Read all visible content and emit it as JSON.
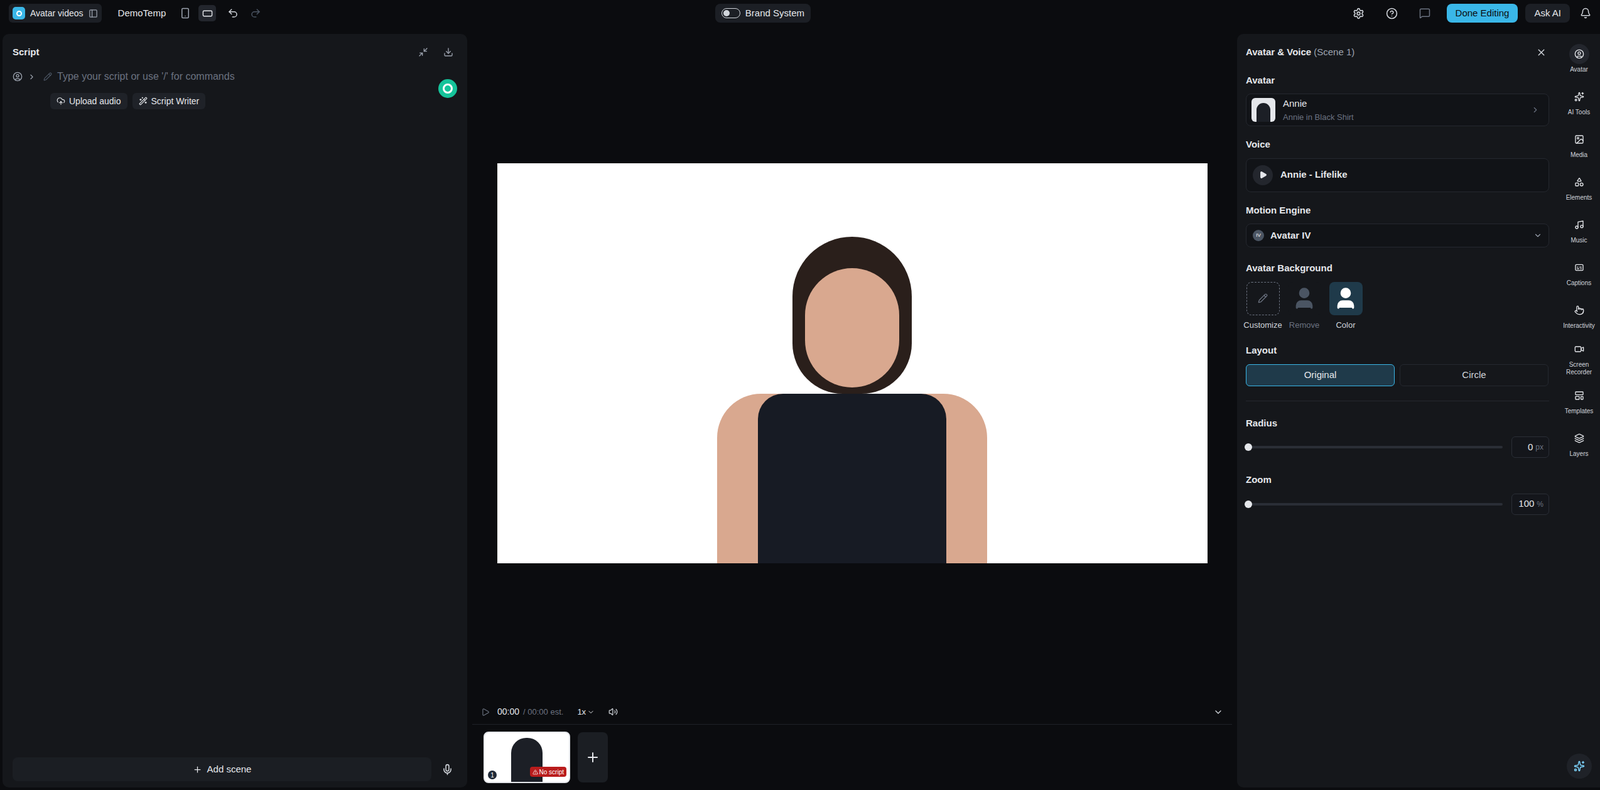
{
  "topbar": {
    "app": "Avatar videos",
    "project": "DemoTemp",
    "brand_toggle": {
      "label": "Brand System",
      "on": false
    },
    "done_button": "Done Editing",
    "ask_button": "Ask AI"
  },
  "script": {
    "title": "Script",
    "placeholder": "Type your script or use '/' for commands",
    "buttons": [
      "Upload audio",
      "Script Writer"
    ],
    "add_scene": "Add scene"
  },
  "player": {
    "time": "00:00",
    "total": "/ 00:00 est.",
    "speed": "1x"
  },
  "scenes": [
    {
      "number": "1",
      "badge": "No script",
      "selected": true
    }
  ],
  "panel": {
    "title": "Avatar & Voice",
    "subtitle": "(Scene 1)",
    "avatar": {
      "label": "Avatar",
      "name": "Annie",
      "outfit": "Annie in Black Shirt"
    },
    "voice": {
      "label": "Voice",
      "name": "Annie - Lifelike"
    },
    "motion": {
      "label": "Motion Engine",
      "badge": "IV",
      "value": "Avatar IV"
    },
    "background": {
      "label": "Avatar Background",
      "options": [
        {
          "label": "Customize",
          "selected": false,
          "disabled": false
        },
        {
          "label": "Remove",
          "selected": false,
          "disabled": true
        },
        {
          "label": "Color",
          "selected": true,
          "disabled": false
        }
      ]
    },
    "layout": {
      "label": "Layout",
      "options": [
        {
          "label": "Original",
          "selected": true
        },
        {
          "label": "Circle",
          "selected": false
        }
      ]
    },
    "radius": {
      "label": "Radius",
      "value": "0",
      "unit": "px",
      "level": 0
    },
    "zoom": {
      "label": "Zoom",
      "value": "100",
      "unit": "%",
      "level": 0
    }
  },
  "rail": [
    {
      "label": "Avatar",
      "selected": true
    },
    {
      "label": "AI Tools",
      "selected": false
    },
    {
      "label": "Media",
      "selected": false
    },
    {
      "label": "Elements",
      "selected": false
    },
    {
      "label": "Music",
      "selected": false
    },
    {
      "label": "Captions",
      "selected": false
    },
    {
      "label": "Interactivity",
      "selected": false
    },
    {
      "label": "Screen Recorder",
      "selected": false
    },
    {
      "label": "Templates",
      "selected": false
    },
    {
      "label": "Layers",
      "selected": false
    }
  ]
}
